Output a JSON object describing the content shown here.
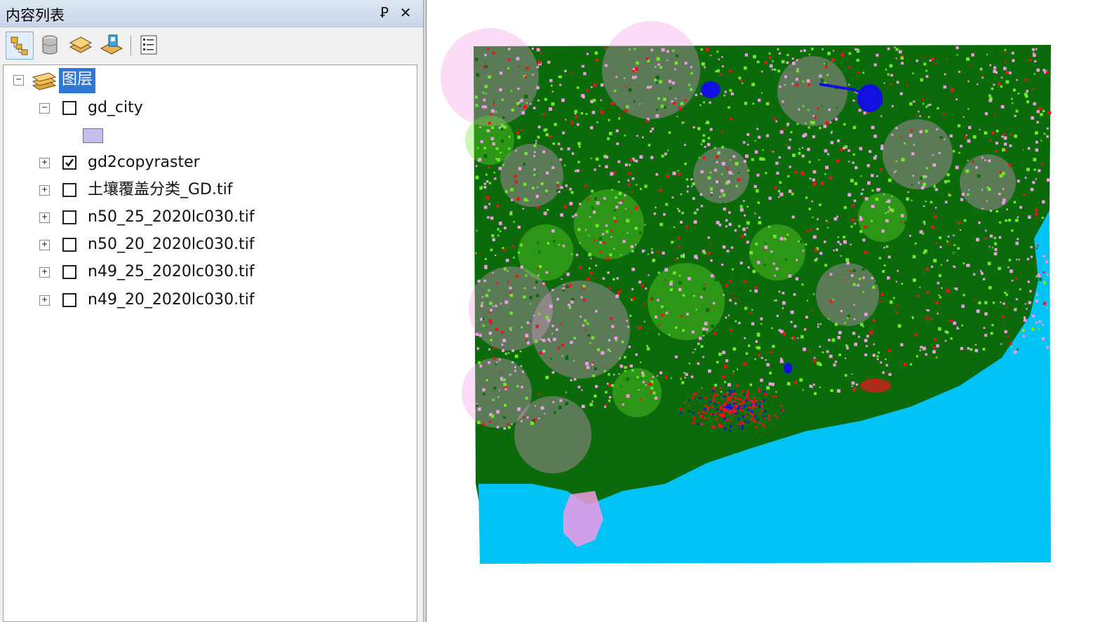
{
  "toc": {
    "title": "内容列表",
    "pin_glyph": "Ꝑ",
    "close_glyph": "✕",
    "toolbar": [
      {
        "name": "list-by-drawing-order-icon",
        "active": true
      },
      {
        "name": "list-by-source-icon",
        "active": false
      },
      {
        "name": "list-by-visibility-icon",
        "active": false
      },
      {
        "name": "list-by-selection-icon",
        "active": false
      },
      {
        "name": "options-icon",
        "active": false
      }
    ],
    "root": {
      "label": "图层",
      "expander": "−"
    },
    "layers": [
      {
        "name": "gd_city",
        "checked": false,
        "expander": "−",
        "has_legend": true
      },
      {
        "name": "gd2copyraster",
        "checked": true,
        "expander": "+"
      },
      {
        "name": "土壤覆盖分类_GD.tif",
        "checked": false,
        "expander": "+"
      },
      {
        "name": "n50_25_2020lc030.tif",
        "checked": false,
        "expander": "+"
      },
      {
        "name": "n50_20_2020lc030.tif",
        "checked": false,
        "expander": "+"
      },
      {
        "name": "n49_25_2020lc030.tif",
        "checked": false,
        "expander": "+"
      },
      {
        "name": "n49_20_2020lc030.tif",
        "checked": false,
        "expander": "+"
      }
    ],
    "legend_color": "#c5c0ec"
  },
  "map": {
    "colors": {
      "forest": "#0b6b0b",
      "grassland": "#6fe82a",
      "cropland": "#f29ae6",
      "urban": "#f0121e",
      "water": "#1210e0",
      "sea": "#00c3f5"
    }
  }
}
